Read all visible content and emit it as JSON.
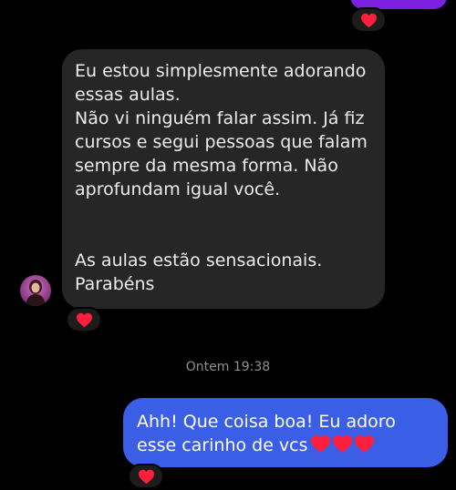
{
  "colors": {
    "background": "#000000",
    "incoming_bubble": "#262626",
    "outgoing_bubble": "#3a5ee5",
    "previous_bubble": "#7b1fe0",
    "heart": "#ff1f3d"
  },
  "thread": {
    "previous_message": {
      "reaction": "heart-icon"
    },
    "incoming": {
      "paragraph_1": "Eu estou simplesmente adorando\nessas aulas.\nNão vi ninguém falar assim. Já fiz\ncursos e segui pessoas que falam\nsempre da mesma forma. Não\naprofundam igual você.",
      "paragraph_2": "As aulas estão sensacionais.\nParabéns",
      "reaction": "heart-icon",
      "avatar": "avatar"
    },
    "timestamp": "Ontem 19:38",
    "outgoing": {
      "text": "Ahh! Que coisa boa! Eu adoro esse carinho de vcs",
      "emoji": "heart-icon x3",
      "reaction": "heart-icon"
    }
  }
}
